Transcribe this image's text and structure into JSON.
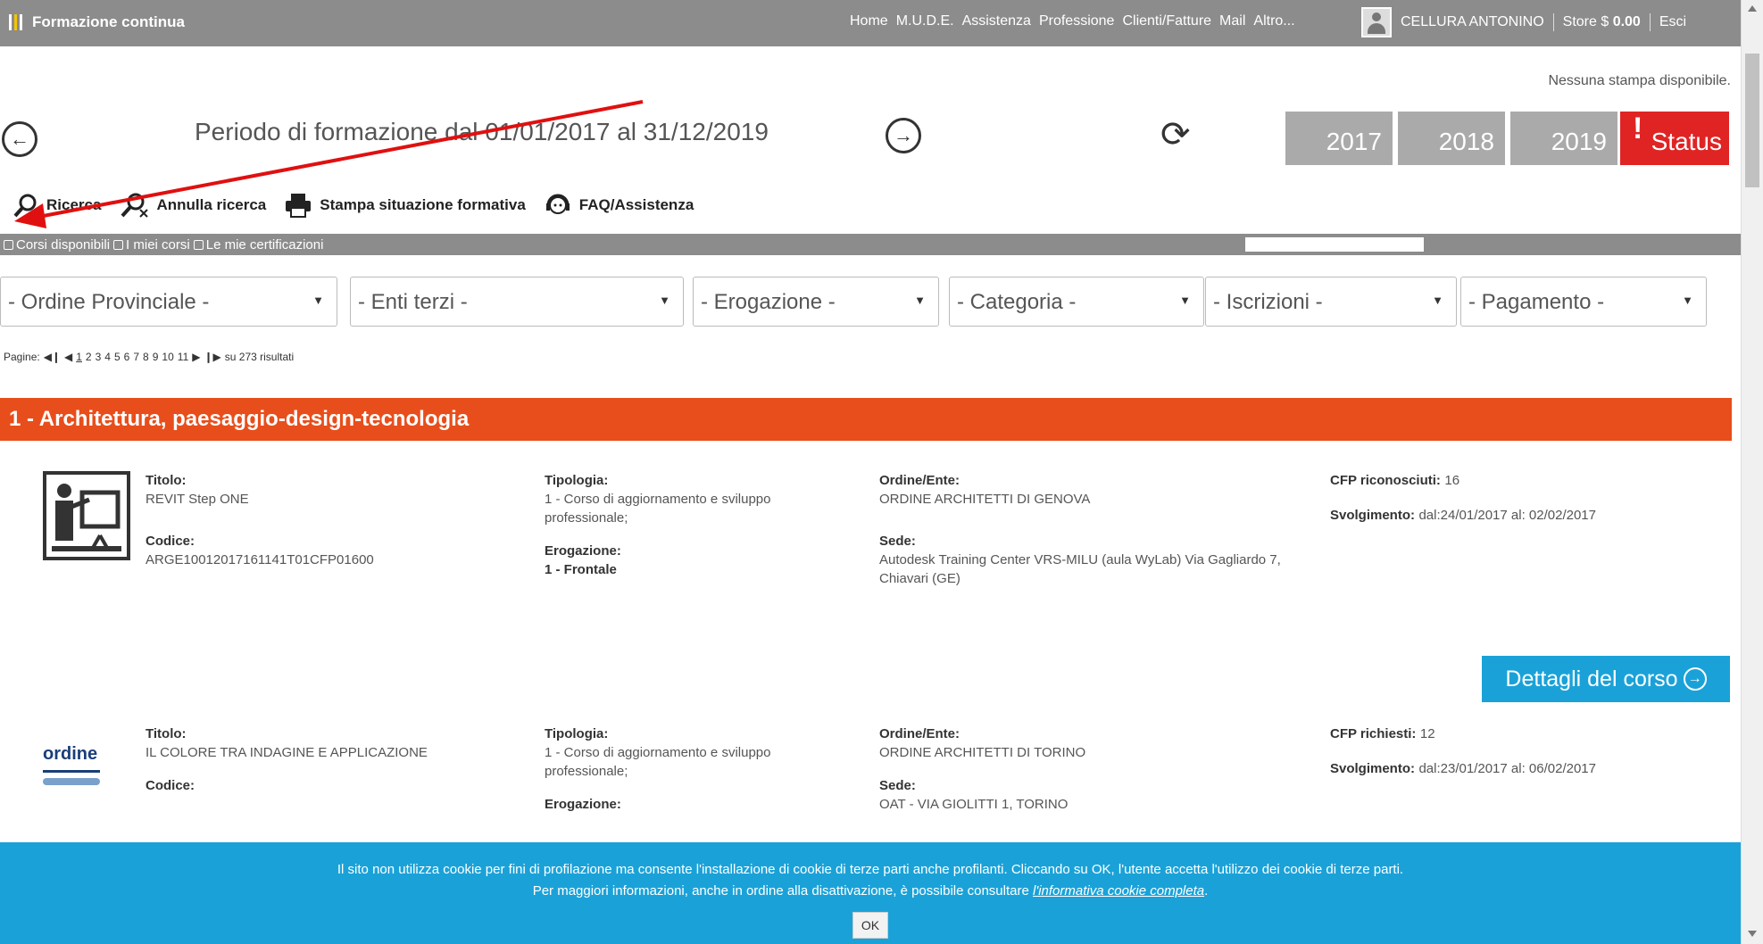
{
  "header": {
    "app_title": "Formazione continua",
    "nav": [
      "Home",
      "M.U.D.E.",
      "Assistenza",
      "Professione",
      "Clienti/Fatture",
      "Mail",
      "Altro..."
    ],
    "user_name": "CELLURA ANTONINO",
    "store_label": "Store $",
    "store_amount": "0.00",
    "logout": "Esci"
  },
  "no_print": "Nessuna stampa disponibile.",
  "period": {
    "title": "Periodo di formazione dal 01/01/2017 al 31/12/2019",
    "years": [
      "2017",
      "2018",
      "2019"
    ],
    "status_label": "Status",
    "status_mark": "!"
  },
  "toolbar": {
    "search": "Ricerca",
    "cancel_search": "Annulla ricerca",
    "print": "Stampa situazione formativa",
    "faq": "FAQ/Assistenza"
  },
  "tabs": [
    "Corsi disponibili",
    "I miei corsi",
    "Le mie certificazioni"
  ],
  "filters": [
    "- Ordine Provinciale -",
    "- Enti terzi -",
    "- Erogazione -",
    "- Categoria -",
    "- Iscrizioni -",
    "- Pagamento -"
  ],
  "pager": {
    "label": "Pagine:",
    "current": "1",
    "pages": [
      "2",
      "3",
      "4",
      "5",
      "6",
      "7",
      "8",
      "9",
      "10",
      "11"
    ],
    "summary": "su 273 risultati"
  },
  "category": "1 - Architettura, paesaggio-design-tecnologia",
  "labels": {
    "titolo": "Titolo:",
    "codice": "Codice:",
    "tipologia": "Tipologia:",
    "erogazione": "Erogazione:",
    "ordine": "Ordine/Ente:",
    "sede": "Sede:",
    "cfp_ric": "CFP riconosciuti:",
    "cfp_rich": "CFP richiesti:",
    "svolgimento": "Svolgimento:"
  },
  "courses": [
    {
      "titolo": "REVIT Step ONE",
      "codice": "ARGE10012017161141T01CFP01600",
      "tipologia": "1 - Corso di aggiornamento e sviluppo professionale;",
      "erogazione": "1 - Frontale",
      "ordine": "ORDINE ARCHITETTI DI GENOVA",
      "sede": "Autodesk Training Center VRS-MILU (aula WyLab) Via Gagliardo 7, Chiavari (GE)",
      "cfp": "16",
      "svolgimento": "dal:24/01/2017 al: 02/02/2017"
    },
    {
      "titolo": "IL COLORE TRA INDAGINE E APPLICAZIONE",
      "codice": "",
      "tipologia": "1 - Corso di aggiornamento e sviluppo professionale;",
      "erogazione": "",
      "ordine": "ORDINE ARCHITETTI DI TORINO",
      "sede": "OAT - VIA GIOLITTI 1, TORINO",
      "cfp": "12",
      "svolgimento": "dal:23/01/2017 al: 06/02/2017",
      "logo_text": "ordine"
    }
  ],
  "details_button": "Dettagli del corso",
  "cookie": {
    "line1": "Il sito non utilizza cookie per fini di profilazione ma consente l'installazione di cookie di terze parti anche profilanti. Cliccando su OK, l'utente accetta l'utilizzo dei cookie di terze parti.",
    "line2_pre": "Per maggiori informazioni, anche in ordine alla disattivazione, è possibile consultare",
    "line2_link": "l'informativa cookie completa",
    "line2_post": ".",
    "ok": "OK"
  },
  "colors": {
    "topbar": "#8c8c8c",
    "category": "#e84e1b",
    "accent_blue": "#1aa2d8",
    "status_red": "#e02424",
    "annotation_arrow": "#e01010"
  }
}
